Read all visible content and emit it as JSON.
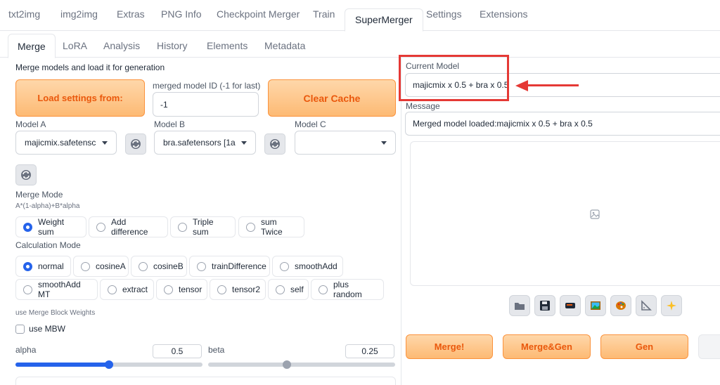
{
  "top_tabs": [
    "txt2img",
    "img2img",
    "Extras",
    "PNG Info",
    "Checkpoint Merger",
    "Train",
    "SuperMerger",
    "Settings",
    "Extensions"
  ],
  "sub_tabs": [
    "Merge",
    "LoRA",
    "Analysis",
    "History",
    "Elements",
    "Metadata"
  ],
  "left": {
    "heading": "Merge models and load it for generation",
    "load_settings_label": "Load settings from:",
    "merged_id_label": "merged model ID (-1 for last)",
    "merged_id_value": "-1",
    "clear_cache_label": "Clear Cache",
    "model_a_label": "Model A",
    "model_a_value": "majicmix.safetensc",
    "model_b_label": "Model B",
    "model_b_value": "bra.safetensors [1a",
    "model_c_label": "Model C",
    "model_c_value": "",
    "merge_mode_label": "Merge Mode",
    "merge_mode_formula": "A*(1-alpha)+B*alpha",
    "merge_modes": [
      "Weight sum",
      "Add difference",
      "Triple sum",
      "sum Twice"
    ],
    "merge_mode_selected": "Weight sum",
    "calc_mode_label": "Calculation Mode",
    "calc_modes_row1": [
      "normal",
      "cosineA",
      "cosineB",
      "trainDifference",
      "smoothAdd"
    ],
    "calc_modes_row2": [
      "smoothAdd MT",
      "extract",
      "tensor",
      "tensor2",
      "self",
      "plus random"
    ],
    "calc_mode_selected": "normal",
    "mbw_section_label": "use Merge Block Weights",
    "mbw_checkbox_label": "use MBW",
    "alpha_label": "alpha",
    "alpha_value": "0.5",
    "alpha_fraction": 0.5,
    "beta_label": "beta",
    "beta_value": "0.25",
    "beta_fraction": 0.42
  },
  "right": {
    "current_model_label": "Current Model",
    "current_model_value": "majicmix x 0.5 + bra x 0.5",
    "message_label": "Message",
    "message_value": "Merged model loaded:majicmix x 0.5 + bra x 0.5",
    "tool_icons": [
      "folder-icon",
      "save-icon",
      "zip-icon",
      "image-icon",
      "palette-icon",
      "ruler-icon",
      "sparkle-icon"
    ],
    "merge_btn_label": "Merge!",
    "merge_gen_btn_label": "Merge&Gen",
    "gen_btn_label": "Gen"
  },
  "colors": {
    "accent_blue": "#2563eb",
    "orange_text": "#ea580c",
    "highlight_red": "#e53935"
  }
}
